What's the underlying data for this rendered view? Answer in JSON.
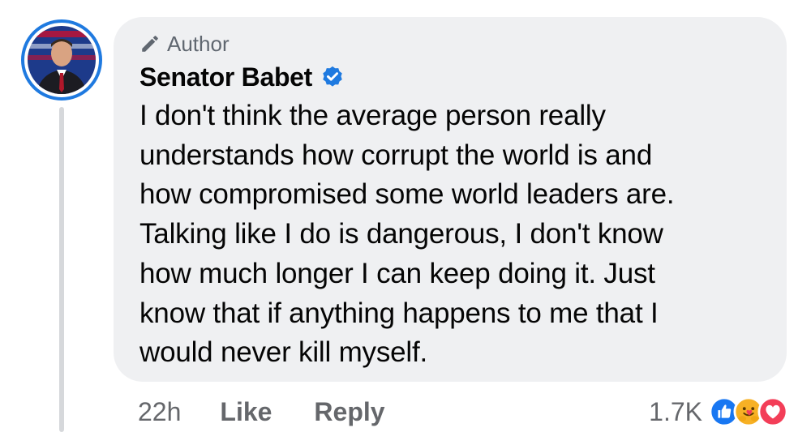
{
  "comment": {
    "author_badge_label": "Author",
    "author_name": "Senator Babet",
    "verified_icon": "verified-badge-icon",
    "text": "I don't think the average person really\nunderstands how corrupt the world is and\nhow compromised some world leaders are.\nTalking like I do is dangerous, I don't know\nhow much longer I can keep doing it. Just\nknow that if anything happens to me that I\nwould never kill myself.",
    "timestamp": "22h",
    "like_label": "Like",
    "reply_label": "Reply",
    "reaction_count": "1.7K",
    "reactions": [
      "like-reaction-icon",
      "care-reaction-icon",
      "love-reaction-icon"
    ]
  },
  "colors": {
    "accent_blue": "#1f7ae0",
    "bubble_bg": "#eff0f2",
    "text_primary": "#050505",
    "text_secondary": "#65676b",
    "love_red": "#f33e58",
    "care_yellow": "#f7b125"
  }
}
